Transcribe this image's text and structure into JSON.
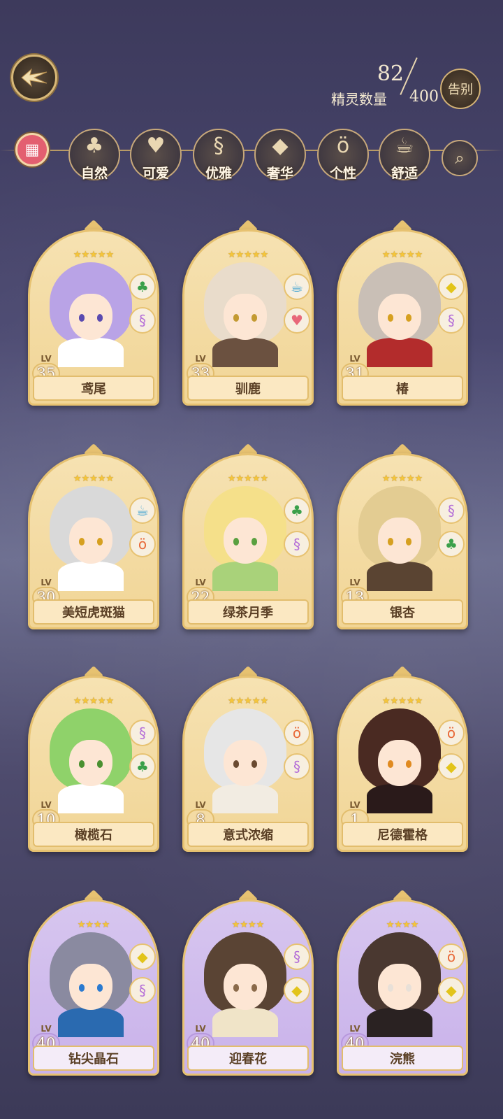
{
  "header": {
    "back_icon": "wing-arrow-back-icon",
    "count_current": "82",
    "count_label": "精灵数量",
    "count_total": "400",
    "farewell_label": "告别"
  },
  "filters": {
    "all_icon": "grid-icon",
    "items": [
      {
        "label": "自然",
        "icon": "clover-icon",
        "glyph": "♣"
      },
      {
        "label": "可爱",
        "icon": "heart-icon",
        "glyph": "♥"
      },
      {
        "label": "优雅",
        "icon": "swan-icon",
        "glyph": "§"
      },
      {
        "label": "奢华",
        "icon": "diamond-icon",
        "glyph": "◆"
      },
      {
        "label": "个性",
        "icon": "glasses-icon",
        "glyph": "ö"
      },
      {
        "label": "舒适",
        "icon": "teacup-icon",
        "glyph": "☕"
      }
    ],
    "search_icon": "search-icon"
  },
  "spirits": [
    {
      "name": "鸢尾",
      "lv_tag": "LV",
      "level": "35",
      "stars": "★★★★★",
      "traits": [
        "clover-icon",
        "swan-icon"
      ],
      "hair": "#b9a3e6",
      "eye": "#5a4ab0",
      "outfit": "#ffffff",
      "theme": "gold"
    },
    {
      "name": "驯鹿",
      "lv_tag": "LV",
      "level": "33",
      "stars": "★★★★★",
      "traits": [
        "teacup-icon",
        "heart-icon"
      ],
      "hair": "#e9dccb",
      "eye": "#c39a32",
      "outfit": "#6b5140",
      "theme": "gold"
    },
    {
      "name": "椿",
      "lv_tag": "LV",
      "level": "31",
      "stars": "★★★★★",
      "traits": [
        "diamond-icon",
        "swan-icon"
      ],
      "hair": "#c9bfb6",
      "eye": "#d6a020",
      "outfit": "#b32c2c",
      "theme": "gold"
    },
    {
      "name": "美短虎斑猫",
      "lv_tag": "LV",
      "level": "30",
      "stars": "★★★★★",
      "traits": [
        "teacup-icon",
        "glasses-icon"
      ],
      "hair": "#d9d9d9",
      "eye": "#d6a020",
      "outfit": "#ffffff",
      "theme": "gold"
    },
    {
      "name": "绿茶月季",
      "lv_tag": "LV",
      "level": "22",
      "stars": "★★★★★",
      "traits": [
        "clover-icon",
        "swan-icon"
      ],
      "hair": "#f5e08a",
      "eye": "#5aa040",
      "outfit": "#a9d27a",
      "theme": "gold"
    },
    {
      "name": "银杏",
      "lv_tag": "LV",
      "level": "13",
      "stars": "★★★★★",
      "traits": [
        "swan-icon",
        "clover-icon"
      ],
      "hair": "#e3cc92",
      "eye": "#d6a020",
      "outfit": "#5a4432",
      "theme": "gold"
    },
    {
      "name": "橄榄石",
      "lv_tag": "LV",
      "level": "10",
      "stars": "★★★★★",
      "traits": [
        "swan-icon",
        "clover-icon"
      ],
      "hair": "#8fd26a",
      "eye": "#4a9030",
      "outfit": "#ffffff",
      "theme": "gold"
    },
    {
      "name": "意式浓缩",
      "lv_tag": "LV",
      "level": "8",
      "stars": "★★★★★",
      "traits": [
        "glasses-icon",
        "swan-icon"
      ],
      "hair": "#e6e6e6",
      "eye": "#6a4a30",
      "outfit": "#f2ece2",
      "theme": "gold"
    },
    {
      "name": "尼德霍格",
      "lv_tag": "LV",
      "level": "1",
      "stars": "★★★★★",
      "traits": [
        "glasses-icon",
        "diamond-icon"
      ],
      "hair": "#4a2a22",
      "eye": "#e08a20",
      "outfit": "#2a1a1a",
      "theme": "gold"
    },
    {
      "name": "钻尖晶石",
      "lv_tag": "LV",
      "level": "40",
      "stars": "★★★★",
      "traits": [
        "diamond-icon",
        "swan-icon"
      ],
      "hair": "#8a8aa0",
      "eye": "#2a7ad0",
      "outfit": "#2a6ab0",
      "theme": "purple"
    },
    {
      "name": "迎春花",
      "lv_tag": "LV",
      "level": "40",
      "stars": "★★★★",
      "traits": [
        "swan-icon",
        "diamond-icon"
      ],
      "hair": "#5a4434",
      "eye": "#8a6a4a",
      "outfit": "#f0e4c8",
      "theme": "purple"
    },
    {
      "name": "浣熊",
      "lv_tag": "LV",
      "level": "40",
      "stars": "★★★★",
      "traits": [
        "glasses-icon",
        "diamond-icon"
      ],
      "hair": "#4a3830",
      "eye": "#e8e0d8",
      "outfit": "#2a2222",
      "theme": "purple"
    }
  ],
  "trait_glyphs": {
    "clover-icon": {
      "glyph": "♣",
      "color": "#3aa04a"
    },
    "heart-icon": {
      "glyph": "♥",
      "color": "#e8687a"
    },
    "swan-icon": {
      "glyph": "§",
      "color": "#b46ed8"
    },
    "diamond-icon": {
      "glyph": "◆",
      "color": "#e2c41a"
    },
    "glasses-icon": {
      "glyph": "ö",
      "color": "#e86a3a"
    },
    "teacup-icon": {
      "glyph": "☕",
      "color": "#3aa0d0"
    }
  }
}
